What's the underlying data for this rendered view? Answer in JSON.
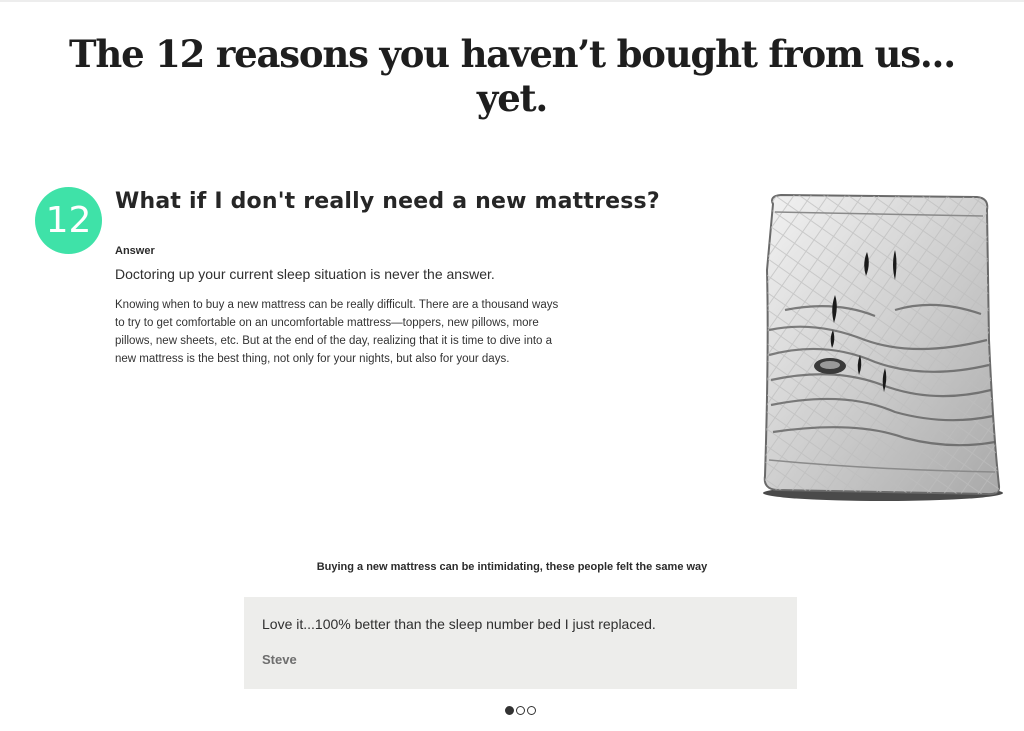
{
  "headline": {
    "line1": "The 12 reasons you haven’t bought from us...",
    "line2": "yet."
  },
  "faq": {
    "number": "12",
    "question": "What if I don't really need a new mattress?",
    "answer_label": "Answer",
    "answer_lead": "Doctoring up your current sleep situation is never the answer.",
    "answer_body": "Knowing when to buy a new mattress can be really difficult. There are a thousand ways to try to get comfortable on an uncomfortable mattress—toppers, new pillows, more pillows, new sheets, etc. But at the end of the day, realizing that it is time to dive into a new mattress is the best thing, not only for your nights, but also for your days."
  },
  "illustration": {
    "icon": "worn-mattress-illustration"
  },
  "reviews": {
    "caption": "Buying a new mattress can be intimidating, these people felt the same way",
    "current": {
      "quote": "Love it...100% better than the sleep number bed I just replaced.",
      "author": "Steve"
    },
    "slide_count": 3,
    "active_slide": 1
  },
  "colors": {
    "badge": "#3fe2a8",
    "card_background": "#ededeb"
  }
}
